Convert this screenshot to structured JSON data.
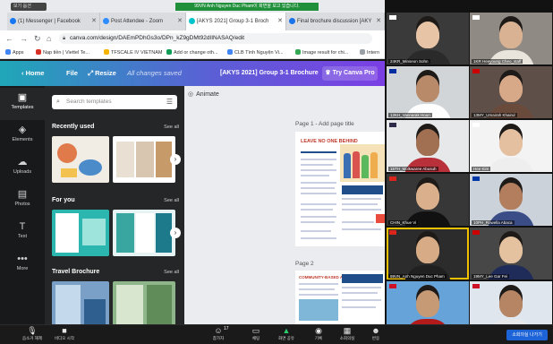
{
  "zoom_banner": "99VN Anh Nguyen Duc Pham이 화면을 보고 있습니다.",
  "window_badge": "보기 옵션",
  "tabs": [
    {
      "title": "(1) Messenger | Facebook",
      "favicon_color": "#1877f2"
    },
    {
      "title": "Post Attendee - Zoom",
      "favicon_color": "#2d8cff"
    },
    {
      "title": "[AKYS 2021] Group 3-1 Broch",
      "favicon_color": "#00c4cc"
    },
    {
      "title": "Final brochure discussion [AKY",
      "favicon_color": "#1a73e8"
    }
  ],
  "url": "canva.com/design/DAEmPDhGs3o/DPn_kZ9gDMt92dIINASAQ/edit",
  "bookmarks": [
    "Apps",
    "Nạp tiền | Viettel Te...",
    "TFSCALE IV VIETNAM",
    "Add or change oth...",
    "CLB Tình Nguyện Vi...",
    "Image result for chi...",
    "Intern"
  ],
  "canva": {
    "home": "Home",
    "file": "File",
    "resize": "Resize",
    "saved_status": "All changes saved",
    "doc_title": "[AKYS 2021] Group 3-1 Brochure",
    "try_pro": "Try Canva Pro",
    "animate": "Animate",
    "page1_label": "Page 1 - Add page title",
    "page2_label": "Page 2",
    "page1_heading": "LEAVE NO ONE BEHIND",
    "page2_heading": "COMMUNITY-BASED ASEAN"
  },
  "rail": [
    {
      "label": "Templates",
      "icon": "templates-icon"
    },
    {
      "label": "Elements",
      "icon": "elements-icon"
    },
    {
      "label": "Uploads",
      "icon": "uploads-icon"
    },
    {
      "label": "Photos",
      "icon": "photos-icon"
    },
    {
      "label": "Text",
      "icon": "text-icon"
    },
    {
      "label": "More",
      "icon": "more-icon"
    }
  ],
  "panel": {
    "search_placeholder": "Search templates",
    "sections": [
      {
        "title": "Recently used",
        "see_all": "See all"
      },
      {
        "title": "For you",
        "see_all": "See all"
      },
      {
        "title": "Travel Brochure",
        "see_all": "See all"
      }
    ]
  },
  "participants": [
    {
      "name": "24KR_Minseon Sohn",
      "skin": "#e8c4a6",
      "shirt": "#2a2a2a",
      "bg": "#3a3a3a",
      "flag": "#ffffff"
    },
    {
      "name": "1KR Heeyoung Cheo_staff",
      "skin": "#d9b193",
      "shirt": "#e9e4dc",
      "bg": "#8f8a84",
      "flag": "#ffffff"
    },
    {
      "name": "12KH_Vannarak Houn",
      "skin": "#b88a6a",
      "shirt": "#fefefe",
      "bg": "#d2d5d8",
      "flag": "#032ea1"
    },
    {
      "name": "13MY_Umairah Khairul",
      "skin": "#d8a989",
      "shirt": "#6a4a3a",
      "bg": "#5e5048",
      "flag": "#cc0001"
    },
    {
      "name": "15TH_Molkwaree Abusuh",
      "skin": "#a17052",
      "shirt": "#b8303a",
      "bg": "#e7e8ea",
      "flag": "#2d2a4a"
    },
    {
      "name": "Hee Kim",
      "skin": "#e4c0a1",
      "shirt": "#eeeeee",
      "bg": "#f3f3f3",
      "flag": "#ffffff"
    },
    {
      "name": "CHIN_Khue Vi",
      "skin": "#dab08c",
      "shirt": "#111111",
      "bg": "#373737",
      "flag": "#da251d"
    },
    {
      "name": "10PH_Rowella Abaca",
      "skin": "#b27e5e",
      "shirt": "#3a4d86",
      "bg": "#cbd2da",
      "flag": "#0038a8"
    },
    {
      "name": "99VN_Anh Nguyen Duc Pham",
      "skin": "#d6ab86",
      "shirt": "#202020",
      "bg": "#2c2c2c",
      "flag": "#da251d"
    },
    {
      "name": "19MY_Lee Gar Fei",
      "skin": "#e4c29f",
      "shirt": "#1f2c5a",
      "bg": "#474747",
      "flag": "#cc0001"
    },
    {
      "name": "SVLA_Khambaycher Khemvilay",
      "skin": "#c79a76",
      "shirt": "#b31a1a",
      "bg": "#66a3d8",
      "flag": "#ce1126"
    },
    {
      "name": "18ID_Waveka Rahadian Abiyoso",
      "skin": "#b58564",
      "shirt": "#e6e8ea",
      "bg": "#dfe6ee",
      "flag": "#ce1126"
    }
  ],
  "zoom_toolbar": [
    {
      "label": "음소거 해제",
      "icon": "microphone-icon"
    },
    {
      "label": "비디오 시작",
      "icon": "video-camera-icon"
    },
    {
      "label": "참가자",
      "icon": "participants-icon",
      "count": "17"
    },
    {
      "label": "채팅",
      "icon": "chat-icon"
    },
    {
      "label": "화면 공유",
      "icon": "share-screen-icon"
    },
    {
      "label": "기록",
      "icon": "record-icon"
    },
    {
      "label": "소회의실",
      "icon": "breakout-rooms-icon"
    },
    {
      "label": "반응",
      "icon": "reactions-icon"
    }
  ],
  "leave_label": "소회의실 나가기",
  "colors": {
    "canva_left": "#1fa7b8",
    "canva_right": "#7b3fe4",
    "zoom_green": "#1f8f3a",
    "zoom_blue": "#1d63d8",
    "speaker_highlight": "#f2c200"
  }
}
